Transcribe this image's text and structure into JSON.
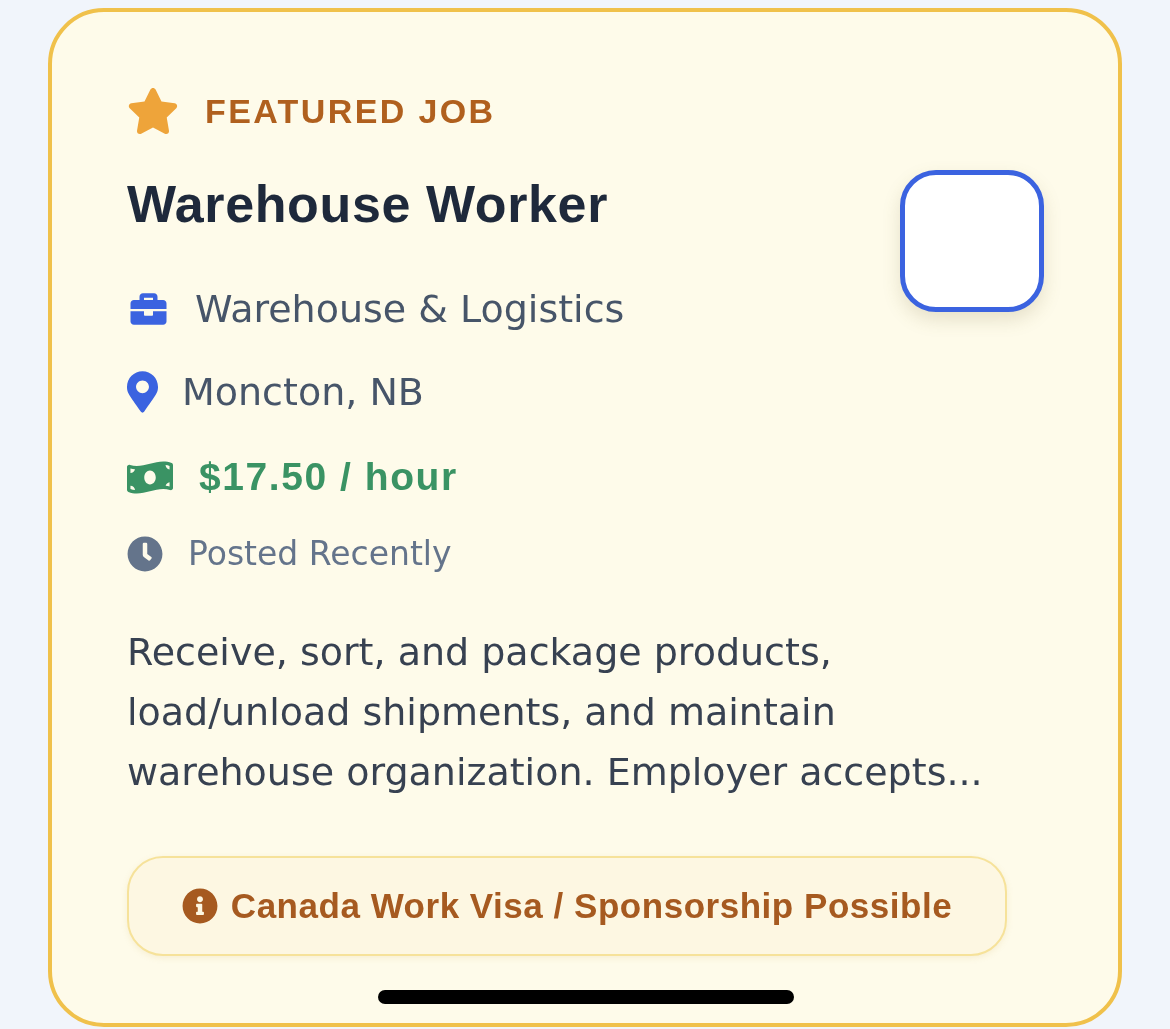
{
  "featured": {
    "label": "FEATURED JOB"
  },
  "job": {
    "title": "Warehouse Worker",
    "details": [
      {
        "kind": "category",
        "text": "Warehouse & Logistics"
      },
      {
        "kind": "location",
        "text": "Moncton, NB"
      },
      {
        "kind": "salary",
        "text": "$17.50 / hour"
      },
      {
        "kind": "posted",
        "text": "Posted Recently"
      }
    ],
    "description": "Receive, sort, and package products, load/unload shipments, and maintain warehouse organization. Employer accepts..."
  },
  "badge": {
    "label": "Canada Work Visa / Sponsorship Possible"
  }
}
